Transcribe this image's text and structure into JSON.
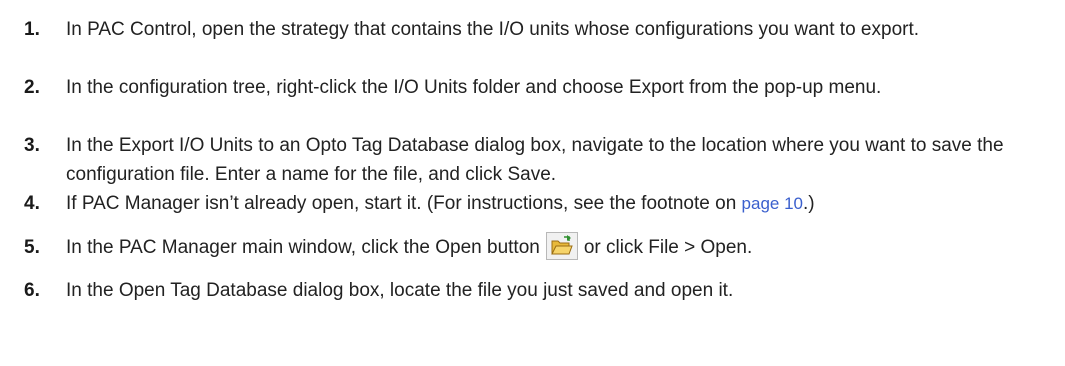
{
  "steps": [
    {
      "number": "1.",
      "text": "In PAC Control, open the strategy that contains the I/O units whose configurations you want to export."
    },
    {
      "number": "2.",
      "text": "In the configuration tree, right-click the I/O Units folder and choose Export from the pop-up menu."
    },
    {
      "number": "3.",
      "text": "In the Export I/O Units to an Opto Tag Database dialog box, navigate to the location where you want to save the configuration file. Enter a name for the file, and click Save."
    },
    {
      "number": "4.",
      "text_before": "If PAC Manager isn’t already open, start it. (For instructions, see the footnote on ",
      "link": "page 10",
      "text_after": ".)"
    },
    {
      "number": "5.",
      "text_before": "In the PAC Manager main window, click the Open button",
      "icon": "open-folder-icon",
      "text_after": "or click File > Open."
    },
    {
      "number": "6.",
      "text": "In the Open Tag Database dialog box, locate the file you just saved and open it."
    }
  ],
  "colors": {
    "link": "#3a5fcd",
    "text": "#222222"
  }
}
